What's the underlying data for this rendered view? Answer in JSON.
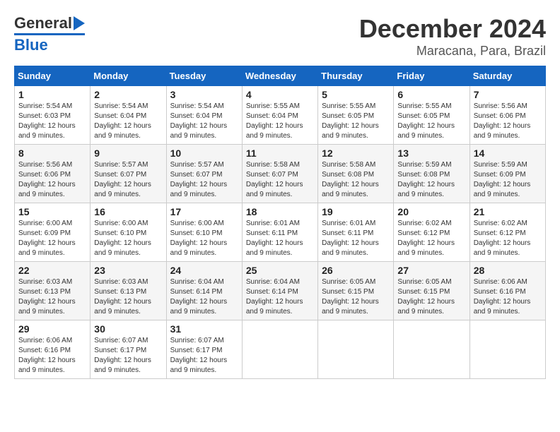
{
  "logo": {
    "line1": "General",
    "line2": "Blue"
  },
  "title": {
    "month": "December 2024",
    "location": "Maracana, Para, Brazil"
  },
  "days_of_week": [
    "Sunday",
    "Monday",
    "Tuesday",
    "Wednesday",
    "Thursday",
    "Friday",
    "Saturday"
  ],
  "weeks": [
    [
      {
        "day": 1,
        "sunrise": "5:54 AM",
        "sunset": "6:03 PM",
        "daylight": "12 hours and 9 minutes."
      },
      {
        "day": 2,
        "sunrise": "5:54 AM",
        "sunset": "6:04 PM",
        "daylight": "12 hours and 9 minutes."
      },
      {
        "day": 3,
        "sunrise": "5:54 AM",
        "sunset": "6:04 PM",
        "daylight": "12 hours and 9 minutes."
      },
      {
        "day": 4,
        "sunrise": "5:55 AM",
        "sunset": "6:04 PM",
        "daylight": "12 hours and 9 minutes."
      },
      {
        "day": 5,
        "sunrise": "5:55 AM",
        "sunset": "6:05 PM",
        "daylight": "12 hours and 9 minutes."
      },
      {
        "day": 6,
        "sunrise": "5:55 AM",
        "sunset": "6:05 PM",
        "daylight": "12 hours and 9 minutes."
      },
      {
        "day": 7,
        "sunrise": "5:56 AM",
        "sunset": "6:06 PM",
        "daylight": "12 hours and 9 minutes."
      }
    ],
    [
      {
        "day": 8,
        "sunrise": "5:56 AM",
        "sunset": "6:06 PM",
        "daylight": "12 hours and 9 minutes."
      },
      {
        "day": 9,
        "sunrise": "5:57 AM",
        "sunset": "6:07 PM",
        "daylight": "12 hours and 9 minutes."
      },
      {
        "day": 10,
        "sunrise": "5:57 AM",
        "sunset": "6:07 PM",
        "daylight": "12 hours and 9 minutes."
      },
      {
        "day": 11,
        "sunrise": "5:58 AM",
        "sunset": "6:07 PM",
        "daylight": "12 hours and 9 minutes."
      },
      {
        "day": 12,
        "sunrise": "5:58 AM",
        "sunset": "6:08 PM",
        "daylight": "12 hours and 9 minutes."
      },
      {
        "day": 13,
        "sunrise": "5:59 AM",
        "sunset": "6:08 PM",
        "daylight": "12 hours and 9 minutes."
      },
      {
        "day": 14,
        "sunrise": "5:59 AM",
        "sunset": "6:09 PM",
        "daylight": "12 hours and 9 minutes."
      }
    ],
    [
      {
        "day": 15,
        "sunrise": "6:00 AM",
        "sunset": "6:09 PM",
        "daylight": "12 hours and 9 minutes."
      },
      {
        "day": 16,
        "sunrise": "6:00 AM",
        "sunset": "6:10 PM",
        "daylight": "12 hours and 9 minutes."
      },
      {
        "day": 17,
        "sunrise": "6:00 AM",
        "sunset": "6:10 PM",
        "daylight": "12 hours and 9 minutes."
      },
      {
        "day": 18,
        "sunrise": "6:01 AM",
        "sunset": "6:11 PM",
        "daylight": "12 hours and 9 minutes."
      },
      {
        "day": 19,
        "sunrise": "6:01 AM",
        "sunset": "6:11 PM",
        "daylight": "12 hours and 9 minutes."
      },
      {
        "day": 20,
        "sunrise": "6:02 AM",
        "sunset": "6:12 PM",
        "daylight": "12 hours and 9 minutes."
      },
      {
        "day": 21,
        "sunrise": "6:02 AM",
        "sunset": "6:12 PM",
        "daylight": "12 hours and 9 minutes."
      }
    ],
    [
      {
        "day": 22,
        "sunrise": "6:03 AM",
        "sunset": "6:13 PM",
        "daylight": "12 hours and 9 minutes."
      },
      {
        "day": 23,
        "sunrise": "6:03 AM",
        "sunset": "6:13 PM",
        "daylight": "12 hours and 9 minutes."
      },
      {
        "day": 24,
        "sunrise": "6:04 AM",
        "sunset": "6:14 PM",
        "daylight": "12 hours and 9 minutes."
      },
      {
        "day": 25,
        "sunrise": "6:04 AM",
        "sunset": "6:14 PM",
        "daylight": "12 hours and 9 minutes."
      },
      {
        "day": 26,
        "sunrise": "6:05 AM",
        "sunset": "6:15 PM",
        "daylight": "12 hours and 9 minutes."
      },
      {
        "day": 27,
        "sunrise": "6:05 AM",
        "sunset": "6:15 PM",
        "daylight": "12 hours and 9 minutes."
      },
      {
        "day": 28,
        "sunrise": "6:06 AM",
        "sunset": "6:16 PM",
        "daylight": "12 hours and 9 minutes."
      }
    ],
    [
      {
        "day": 29,
        "sunrise": "6:06 AM",
        "sunset": "6:16 PM",
        "daylight": "12 hours and 9 minutes."
      },
      {
        "day": 30,
        "sunrise": "6:07 AM",
        "sunset": "6:17 PM",
        "daylight": "12 hours and 9 minutes."
      },
      {
        "day": 31,
        "sunrise": "6:07 AM",
        "sunset": "6:17 PM",
        "daylight": "12 hours and 9 minutes."
      },
      null,
      null,
      null,
      null
    ]
  ]
}
